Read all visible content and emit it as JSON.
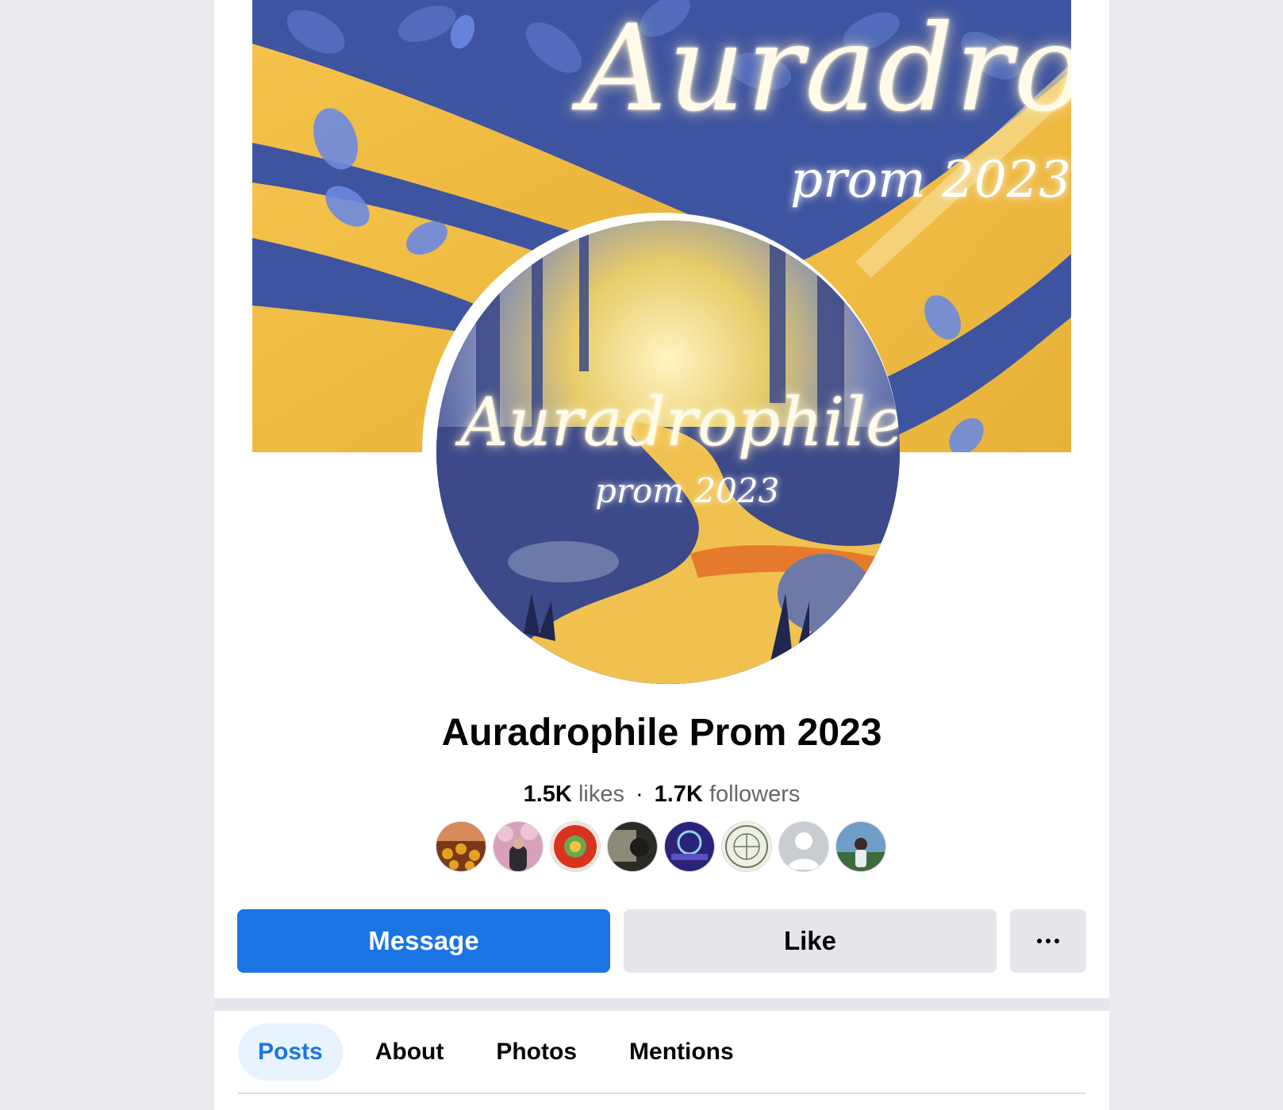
{
  "cover": {
    "script_text": "Auradro",
    "sub_text": "prom 2023"
  },
  "avatar": {
    "script_text": "Auradrophile",
    "sub_text": "prom 2023"
  },
  "page": {
    "title": "Auradrophile Prom 2023",
    "likes_count": "1.5K",
    "likes_label": "likes",
    "separator": "·",
    "followers_count": "1.7K",
    "followers_label": "followers"
  },
  "friends": [
    {
      "name": "friend-avatar-sunflowers",
      "color": "#8a3b1c"
    },
    {
      "name": "friend-avatar-blossoms",
      "color": "#c98aa8"
    },
    {
      "name": "friend-avatar-red-logo",
      "color": "#d9321f"
    },
    {
      "name": "friend-avatar-dark-photo",
      "color": "#5b5a4e"
    },
    {
      "name": "friend-avatar-mathematics",
      "color": "#3c2f8a"
    },
    {
      "name": "friend-avatar-seal",
      "color": "#d9dccf"
    },
    {
      "name": "friend-avatar-default",
      "color": "#c9ccd1"
    },
    {
      "name": "friend-avatar-person",
      "color": "#4a6f8f"
    }
  ],
  "actions": {
    "message_label": "Message",
    "like_label": "Like",
    "more_icon": "ellipsis-icon"
  },
  "tabs": [
    {
      "label": "Posts",
      "active": true
    },
    {
      "label": "About",
      "active": false
    },
    {
      "label": "Photos",
      "active": false
    },
    {
      "label": "Mentions",
      "active": false
    }
  ],
  "colors": {
    "accent": "#1b74e4",
    "secondary_button": "#e4e6eb",
    "active_tab_bg": "#e7f3ff"
  }
}
